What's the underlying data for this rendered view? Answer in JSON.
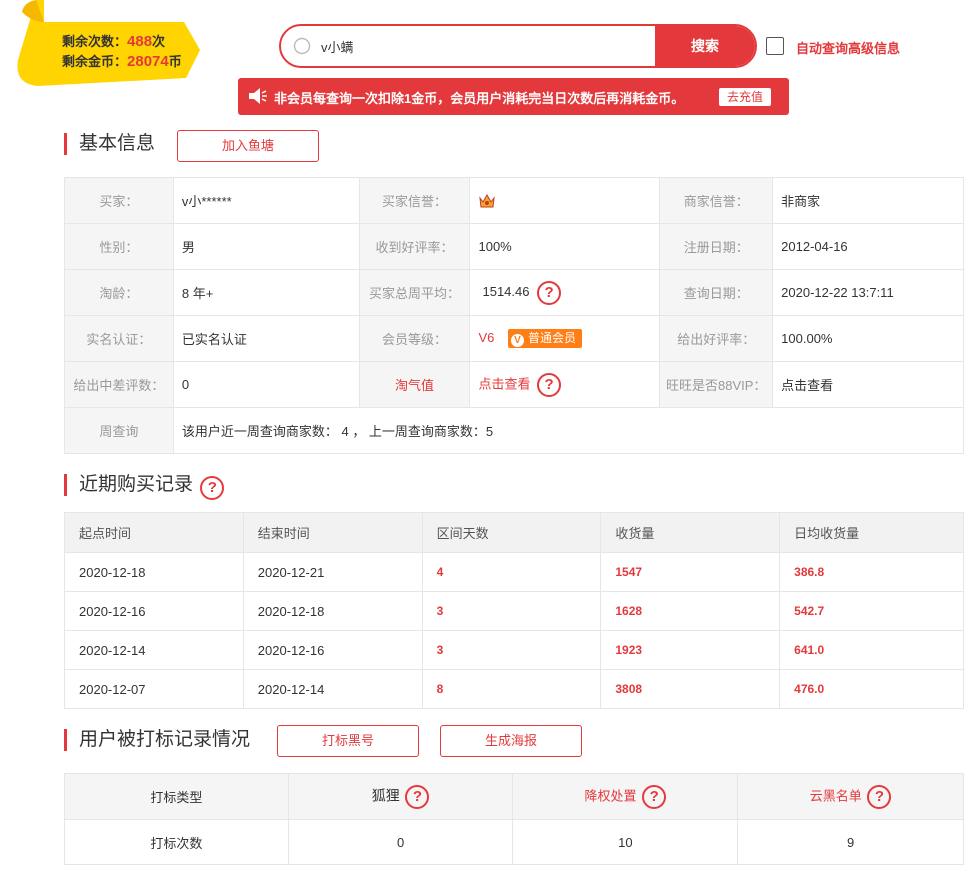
{
  "badge": {
    "remaining_count_label": "剩余次数：",
    "remaining_count": "488",
    "remaining_count_unit": "次",
    "remaining_coins_label": "剩余金币：",
    "remaining_coins": "28074",
    "remaining_coins_unit": "币"
  },
  "search": {
    "value": "v小螨",
    "button_label": "搜索",
    "auto_query_label": "自动查询高级信息"
  },
  "notice": {
    "text": "非会员每查询一次扣除1金币，会员用户消耗完当日次数后再消耗金币。",
    "recharge_label": "去充值"
  },
  "basic_info": {
    "title": "基本信息",
    "add_pond_label": "加入鱼塘",
    "rows": [
      [
        "买家：",
        "v小******",
        "买家信誉：",
        "",
        "商家信誉：",
        "非商家"
      ],
      [
        "性别：",
        "男",
        "收到好评率：",
        "100%",
        "注册日期：",
        "2012-04-16"
      ],
      [
        "淘龄：",
        "8 年+",
        "买家总周平均：",
        "1514.46",
        "查询日期：",
        "2020-12-22 13:7:11"
      ],
      [
        "实名认证：",
        "已实名认证",
        "会员等级：",
        "V6",
        "给出好评率：",
        "100.00%"
      ],
      [
        "给出中差评数：",
        "0",
        "淘气值",
        "点击查看",
        "旺旺是否88VIP：",
        "点击查看"
      ]
    ],
    "vip_tag": "普通会员",
    "vip_tag_letter": "V",
    "weekly_label": "周查询",
    "weekly_text": "该用户近一周查询商家数： 4 ， 上一周查询商家数：5"
  },
  "purchase": {
    "title": "近期购买记录",
    "headers": [
      "起点时间",
      "结束时间",
      "区间天数",
      "收货量",
      "日均收货量"
    ],
    "rows": [
      [
        "2020-12-18",
        "2020-12-21",
        "4",
        "1547",
        "386.8"
      ],
      [
        "2020-12-16",
        "2020-12-18",
        "3",
        "1628",
        "542.7"
      ],
      [
        "2020-12-14",
        "2020-12-16",
        "3",
        "1923",
        "641.0"
      ],
      [
        "2020-12-07",
        "2020-12-14",
        "8",
        "3808",
        "476.0"
      ]
    ]
  },
  "marks": {
    "title": "用户被打标记录情况",
    "blacklist_btn": "打标黑号",
    "poster_btn": "生成海报",
    "headers": [
      "打标类型",
      "狐狸",
      "降权处置",
      "云黑名单"
    ],
    "count_label": "打标次数",
    "counts": [
      "0",
      "10",
      "9"
    ]
  },
  "help_glyph": "?",
  "colors": {
    "accent": "#e4393c",
    "badge_yellow": "#ffd400",
    "vip_orange": "#ff7e15"
  },
  "icons": [
    "search-icon",
    "megaphone-icon",
    "crown-icon",
    "help-icon"
  ]
}
